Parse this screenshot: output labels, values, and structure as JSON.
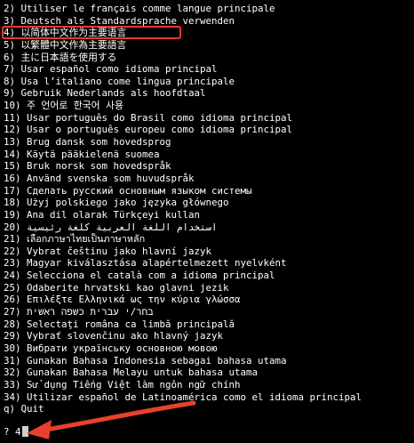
{
  "colors": {
    "background": "#000000",
    "text": "#ffffff",
    "highlight": "#e53935",
    "arrow": "#e8412c"
  },
  "lines": [
    "2) Utiliser le français comme langue principale",
    "3) Deutsch als Standardsprache verwenden",
    "4) 以简体中文作为主要语言",
    "5) 以繁體中文作為主要語言",
    "6) 主に日本語を使用する",
    "7) Usar español como idioma principal",
    "8) Usa l’italiano come lingua principale",
    "9) Gebruik Nederlands als hoofdtaal",
    "10) 주 언어로 한국어 사용",
    "11) Usar português do Brasil como idioma principal",
    "12) Usar o português europeu como idioma principal",
    "13) Brug dansk som hovedsprog",
    "14) Käytä pääkielenä suomea",
    "15) Bruk norsk som hovedspråk",
    "16) Använd svenska som huvudspråk",
    "17) Сделать русский основным языком системы",
    "18) Użyj polskiego jako języka głównego",
    "19) Ana dil olarak Türkçeyi kullan",
    "20) استخدام اللغة العربية كلغة رئيسية",
    "21) เลือกภาษาไทยเป็นภาษาหลัก",
    "22) Vybrat češtinu jako hlavní jazyk",
    "23) Magyar kiválasztása alapértelmezett nyelvként",
    "24) Selecciona el català com a idioma principal",
    "25) Odaberite hrvatski kao glavni jezik",
    "26) Επιλέξτε Ελληνικά ως την κύρια γλώσσα",
    "27) בחר/י עברית כשפה ראשית",
    "28) Selectaţi româna ca limbă principală",
    "29) Vybrať slovenčinu ako hlavný jazyk",
    "30) Вибрати українську основною мовою",
    "31) Gunakan Bahasa Indonesia sebagai bahasa utama",
    "32) Gunakan Bahasa Melayu untuk bahasa utama",
    "33) Sử dụng Tiếng Việt làm ngôn ngữ chính",
    "34) Utilizar español de Latinoamérica como el idioma principal",
    "q) Quit"
  ],
  "prompt": {
    "symbol": "?",
    "input": "4"
  },
  "highlighted_option": "4"
}
